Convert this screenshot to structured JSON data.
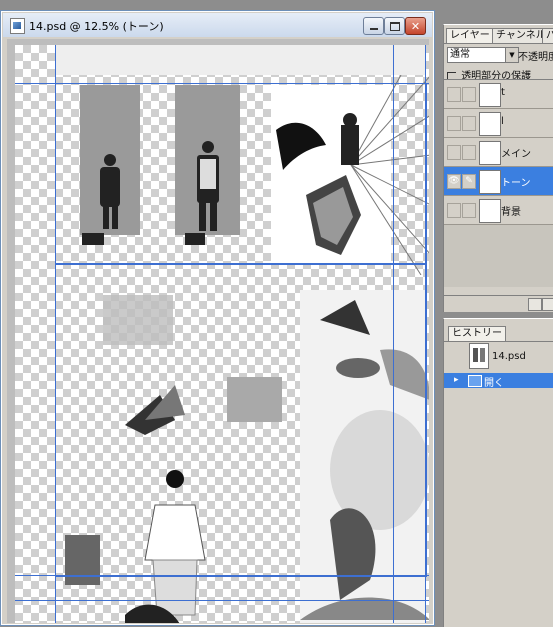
{
  "document": {
    "title": "14.psd @ 12.5% (トーン)"
  },
  "layers_panel": {
    "tabs": [
      "レイヤー",
      "チャンネル",
      "パ"
    ],
    "blend_mode": "通常",
    "opacity_label": "不透明度",
    "lock_label": "透明部分の保護",
    "layers": [
      {
        "name": "t",
        "visible": false,
        "selected": false,
        "transparent_thumb": true
      },
      {
        "name": "l",
        "visible": false,
        "selected": false,
        "transparent_thumb": true
      },
      {
        "name": "メイン",
        "visible": false,
        "selected": false,
        "transparent_thumb": true
      },
      {
        "name": "トーン",
        "visible": true,
        "selected": true,
        "transparent_thumb": true
      },
      {
        "name": "背景",
        "visible": false,
        "selected": false,
        "transparent_thumb": false
      }
    ]
  },
  "history_panel": {
    "tab": "ヒストリー",
    "snapshot_name": "14.psd",
    "steps": [
      "開く"
    ]
  },
  "colors": {
    "selection_blue": "#3b7fe0",
    "guide_blue": "#3d6fd1"
  },
  "icons": {
    "visibility": "eye-icon",
    "link": "brush-icon",
    "app_document": "psd-document-icon"
  }
}
